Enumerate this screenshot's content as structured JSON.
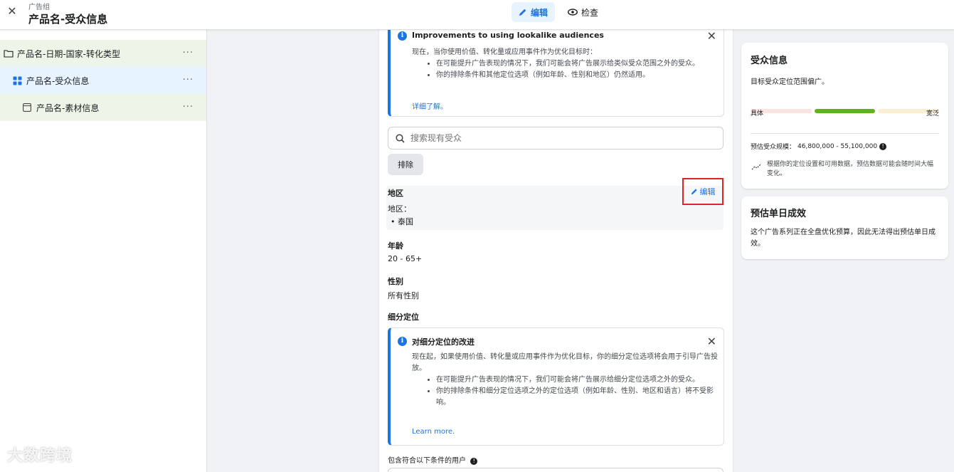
{
  "header": {
    "close_icon": "close-icon",
    "breadcrumb": "广告组",
    "title": "产品名-受众信息",
    "edit_label": "编辑",
    "review_label": "检查",
    "accent_color": "#1b74e4"
  },
  "sidebar": {
    "items": [
      {
        "label": "产品名-日期-国家-转化类型",
        "icon": "folder-icon",
        "more": "···"
      },
      {
        "label": "产品名-受众信息",
        "icon": "grid-icon",
        "more": "···"
      },
      {
        "label": "产品名-素材信息",
        "icon": "ad-icon",
        "more": "···"
      }
    ]
  },
  "watermark": "大数跨境",
  "lookalike_notice": {
    "title": "Improvements to using lookalike audiences",
    "intro": "现在，当你使用价值、转化量或应用事件作为优化目标时：",
    "bullets": [
      "在可能提升广告表现的情况下，我们可能会将广告展示给类似受众范围之外的受众。",
      "你的排除条件和其他定位选项（例如年龄、性别和地区）仍然适用。"
    ],
    "link": "详细了解。"
  },
  "search": {
    "placeholder": "搜索现有受众"
  },
  "exclude_button": "排除",
  "location": {
    "heading": "地区",
    "edit_label": "编辑",
    "sub_label": "地区：",
    "value": "泰国"
  },
  "age": {
    "heading": "年龄",
    "value": "20 - 65+"
  },
  "gender": {
    "heading": "性别",
    "value": "所有性别"
  },
  "detailed_targeting": {
    "heading": "细分定位"
  },
  "detailed_notice": {
    "title": "对细分定位的改进",
    "intro": "现在起，如果使用价值、转化量或应用事件作为优化目标，你的细分定位选项将会用于引导广告投放。",
    "bullets": [
      "在可能提升广告表现的情况下，我们可能会将广告展示给细分定位选项之外的受众。",
      "你的排除条件和细分定位选项之外的定位选项（例如年龄、性别、地区和语言）将不受影响。"
    ],
    "link": "Learn more."
  },
  "include_label": "包含符合以下条件的用户",
  "audience_card": {
    "title": "受众信息",
    "subtitle": "目标受众定位范围偏广。",
    "meter_colors": [
      "#fbe3e0",
      "#5fb31f",
      "#fbeed3"
    ],
    "left_label": "具体",
    "right_label": "宽泛",
    "estimate_label": "预估受众规模：",
    "estimate_value": "46,800,000 - 55,100,000",
    "note": "根据你的定位设置和可用数据，预估数据可能会随时间大幅变化。"
  },
  "results_card": {
    "title": "预估单日成效",
    "text": "这个广告系列正在全盘优化预算，因此无法得出预估单日成效。"
  }
}
